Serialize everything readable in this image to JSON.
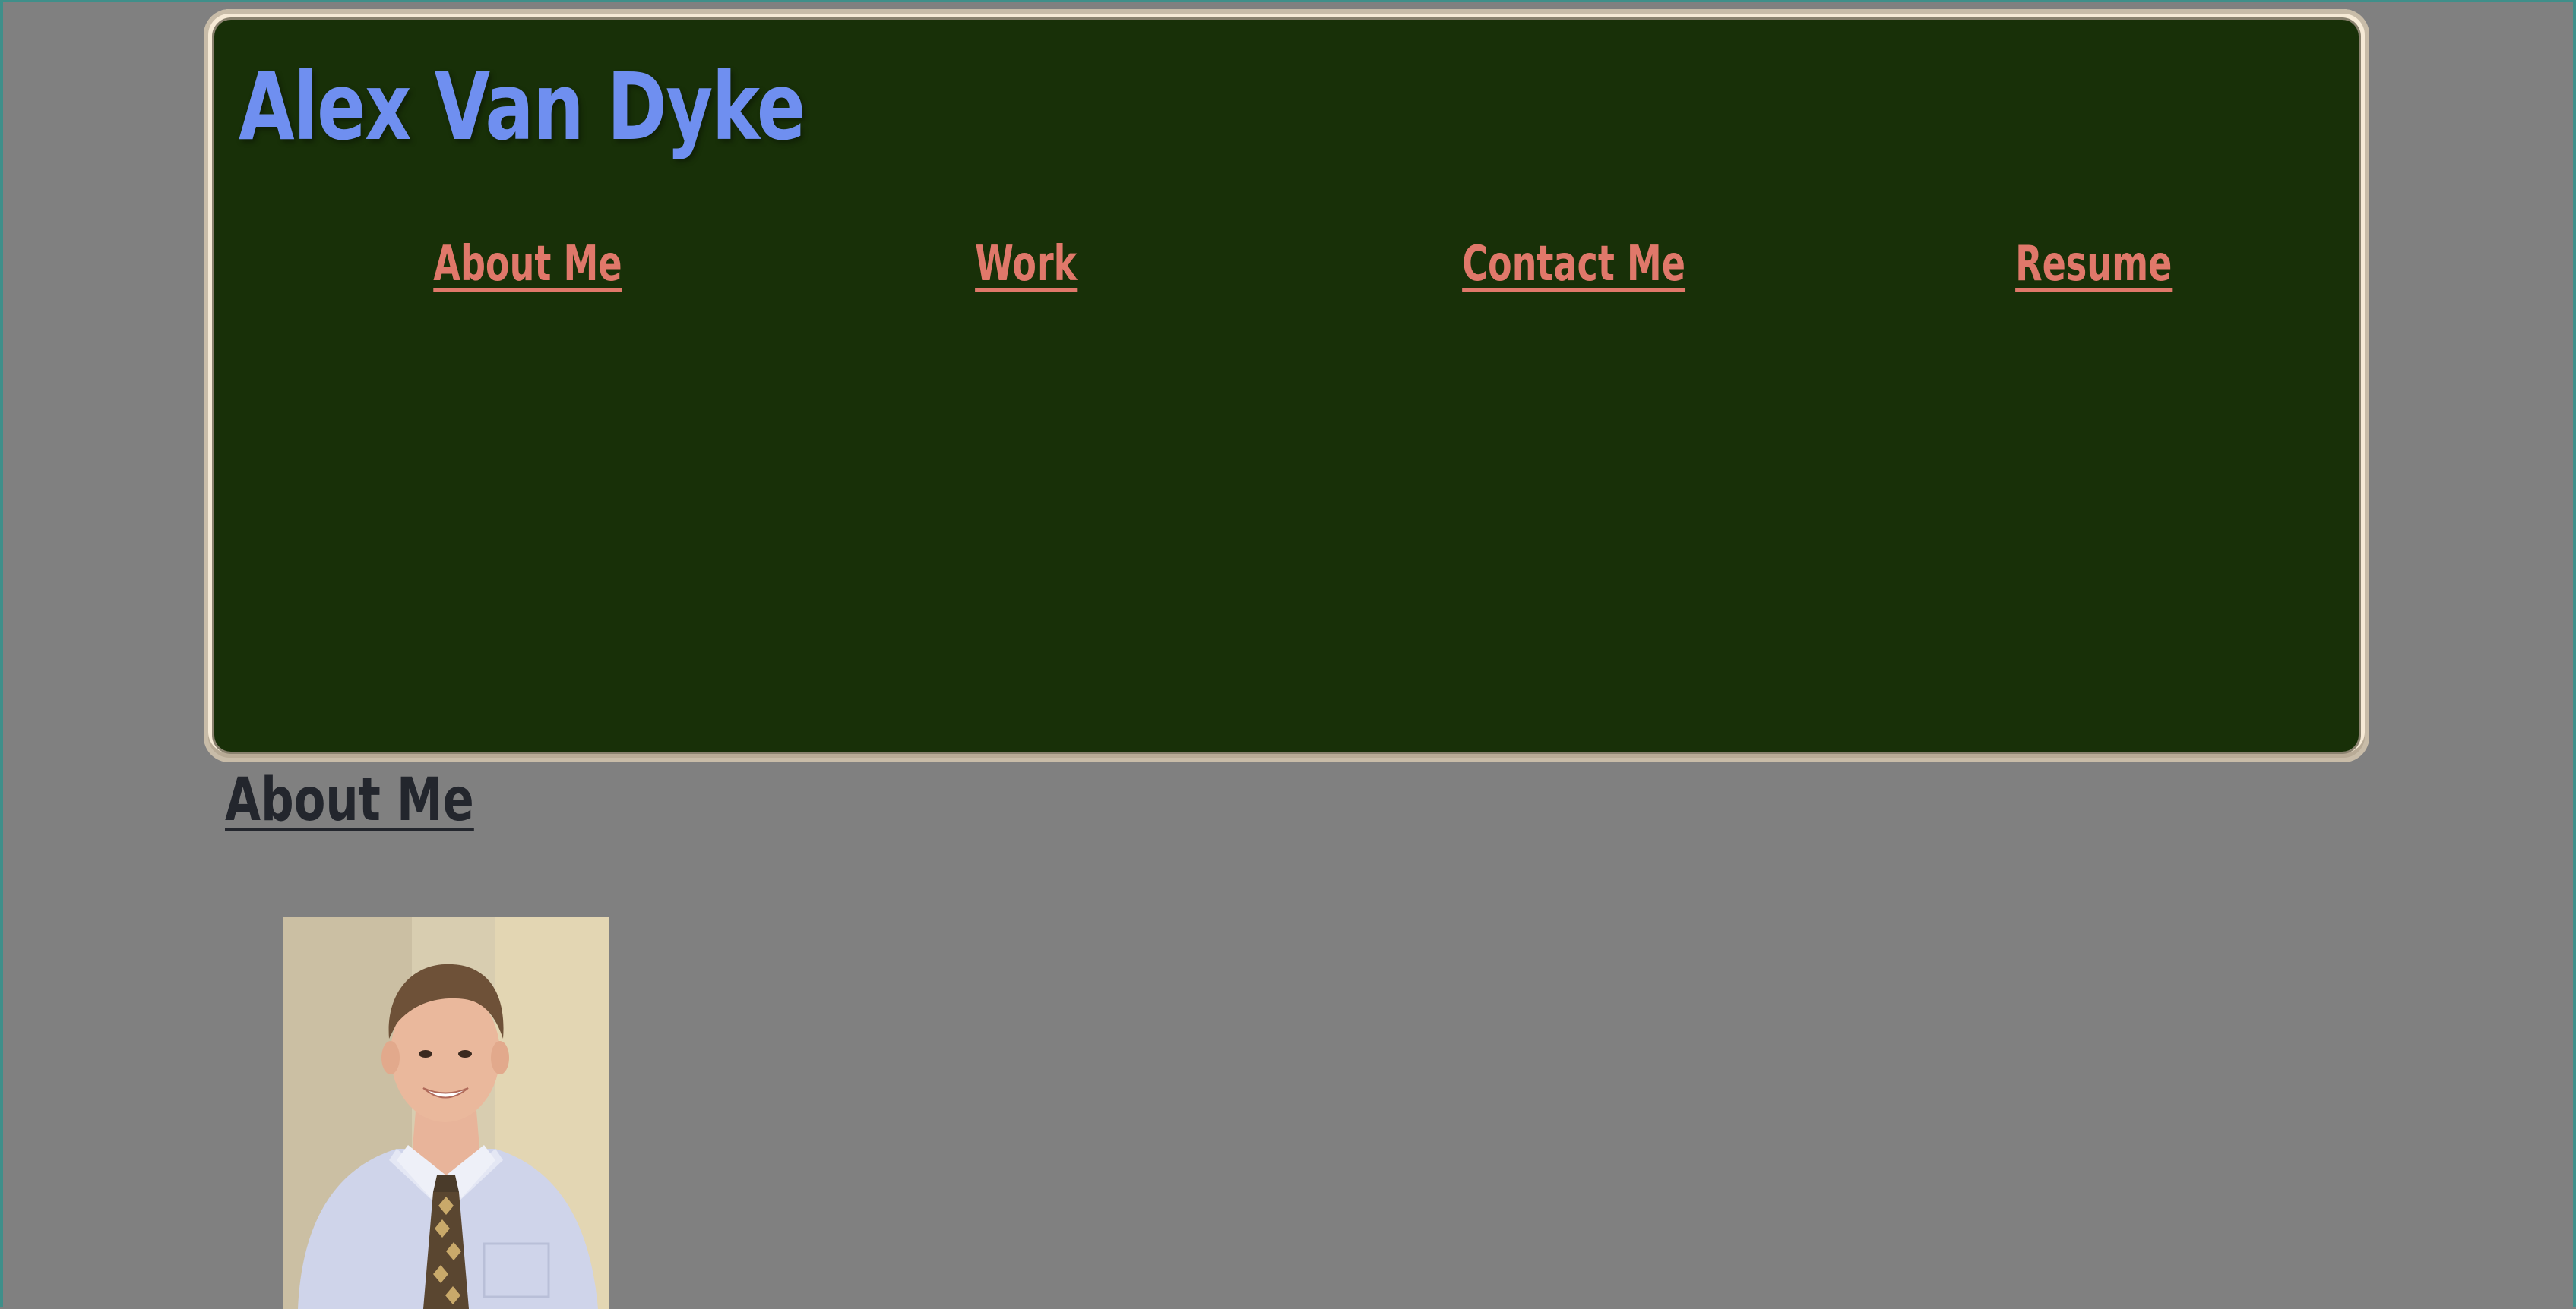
{
  "header": {
    "title": "Alex Van Dyke"
  },
  "nav": {
    "items": [
      {
        "label": "About Me"
      },
      {
        "label": "Work"
      },
      {
        "label": "Contact Me"
      },
      {
        "label": "Resume"
      }
    ]
  },
  "about": {
    "heading": "About Me"
  },
  "colors": {
    "page_bg": "#808080",
    "header_bg": "#183008",
    "header_border": "#f6ead6",
    "title": "#6f8ff0",
    "nav_link": "#e0786a",
    "section_heading": "#23262d"
  }
}
